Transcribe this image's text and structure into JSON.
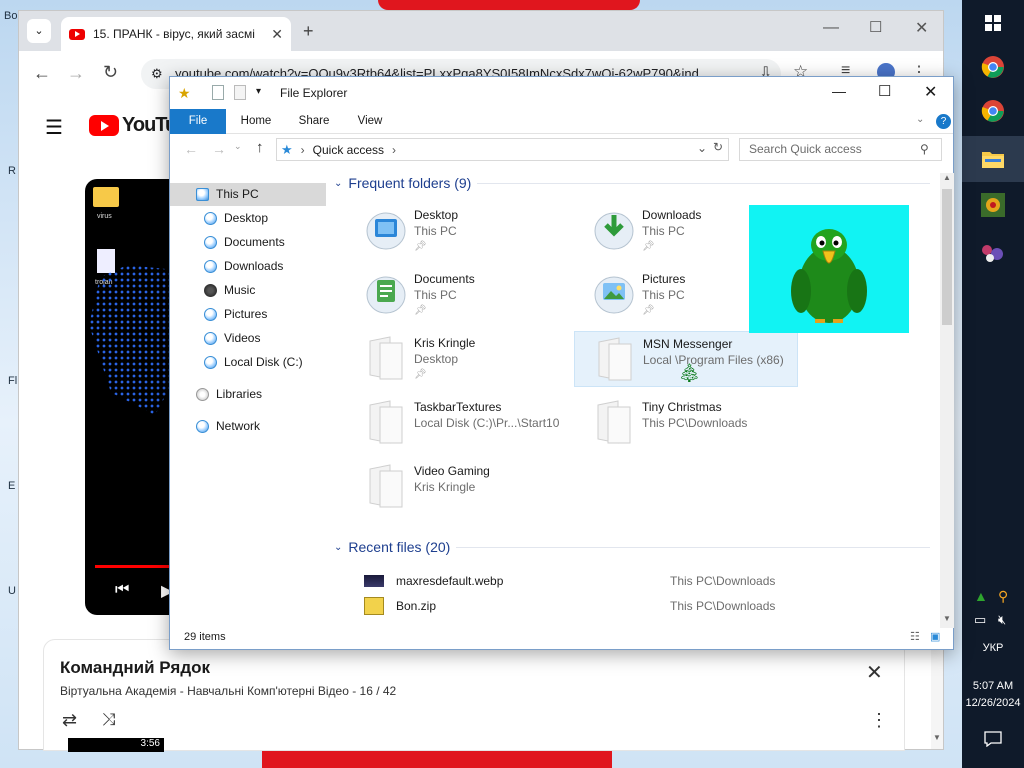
{
  "desktop": {
    "left_texts": [
      "Bo",
      "R",
      "Fl",
      "E",
      "U"
    ]
  },
  "taskbar": {
    "time": "5:07 AM",
    "date": "12/26/2024",
    "language": "УКР"
  },
  "browser": {
    "tab_title": "15. ПРАНК - вірус, який засмі",
    "url": "youtube.com/watch?v=OOu9v3Rtb64&list=PLxxPga8YS0I58ImNcxSdx7wOi-62wP790&ind...",
    "youtube_logo": "YouTube",
    "video_desktop_labels": [
      "virus",
      "trojan"
    ],
    "playlist": {
      "title": "Командний Рядок",
      "subtitle": "Віртуальна Академія - Навчальні Комп'ютерні Відео - 16 / 42",
      "thumb_time": "3:56"
    }
  },
  "explorer": {
    "window_title": "File Explorer",
    "ribbon_tabs": [
      "File",
      "Home",
      "Share",
      "View"
    ],
    "breadcrumb": "Quick access",
    "search_placeholder": "Search Quick access",
    "nav": [
      {
        "label": "This PC",
        "icon": "this-pc-icon"
      },
      {
        "label": "Desktop",
        "icon": "desktop-icon"
      },
      {
        "label": "Documents",
        "icon": "documents-icon"
      },
      {
        "label": "Downloads",
        "icon": "downloads-icon"
      },
      {
        "label": "Music",
        "icon": "music-icon"
      },
      {
        "label": "Pictures",
        "icon": "pictures-icon"
      },
      {
        "label": "Videos",
        "icon": "videos-icon"
      },
      {
        "label": "Local Disk (C:)",
        "icon": "disk-icon"
      },
      {
        "label": "Libraries",
        "icon": "libraries-icon"
      },
      {
        "label": "Network",
        "icon": "network-icon"
      }
    ],
    "frequent_header": "Frequent folders (9)",
    "frequent": [
      {
        "name": "Desktop",
        "location": "This PC",
        "icon": "desktop-folder-icon"
      },
      {
        "name": "Downloads",
        "location": "This PC",
        "icon": "downloads-folder-icon"
      },
      {
        "name": "Documents",
        "location": "This PC",
        "icon": "documents-folder-icon"
      },
      {
        "name": "Pictures",
        "location": "This PC",
        "icon": "pictures-folder-icon"
      },
      {
        "name": "Kris Kringle",
        "location": "Desktop",
        "icon": "folder-icon"
      },
      {
        "name": "MSN Messenger",
        "location": "Local \\Program Files (x86)",
        "icon": "folder-icon"
      },
      {
        "name": "TaskbarTextures",
        "location": "Local Disk (C:)\\Pr...\\Start10",
        "icon": "folder-icon"
      },
      {
        "name": "Tiny Christmas",
        "location": "This PC\\Downloads",
        "icon": "folder-icon"
      },
      {
        "name": "Video Gaming",
        "location": "Kris Kringle",
        "icon": "folder-icon"
      }
    ],
    "recent_header": "Recent files (20)",
    "recent": [
      {
        "name": "maxresdefault.webp",
        "location": "This PC\\Downloads"
      },
      {
        "name": "Bon.zip",
        "location": "This PC\\Downloads"
      }
    ],
    "status": "29 items",
    "colors": {
      "file_tab": "#1979ca",
      "group_header": "#1e3f8f",
      "parrot_bg": "#11f3f3"
    }
  }
}
